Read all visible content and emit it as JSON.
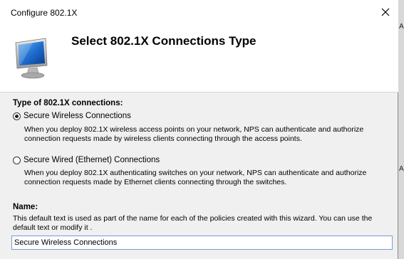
{
  "window": {
    "title": "Configure 802.1X"
  },
  "header": {
    "title": "Select 802.1X Connections Type"
  },
  "connections": {
    "section_label": "Type of 802.1X connections:",
    "options": [
      {
        "label": "Secure Wireless Connections",
        "checked": true,
        "description_line1": "When you deploy 802.1X wireless access points on your network, NPS can authenticate and authorize",
        "description_line2": "connection requests made by wireless clients connecting through the access points."
      },
      {
        "label": "Secure Wired (Ethernet) Connections",
        "checked": false,
        "description_line1": "When you deploy 802.1X authenticating switches on your network, NPS can authenticate and authorize",
        "description_line2": "connection requests made by Ethernet clients connecting through the switches."
      }
    ]
  },
  "name_section": {
    "label": "Name:",
    "description_line1": "This default text is used as part of the name for each of the policies created with this wizard. You can use the",
    "description_line2": "default text or modify it .",
    "value": "Secure Wireless Connections"
  },
  "background_window": {
    "edge_glyphs": [
      "A",
      "A"
    ]
  }
}
